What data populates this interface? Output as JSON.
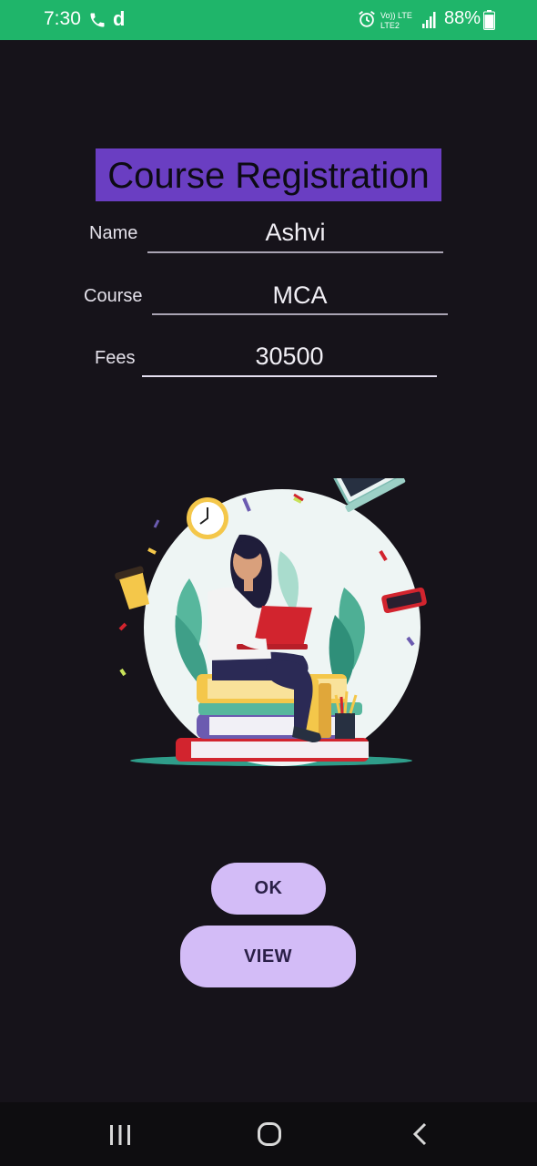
{
  "status_bar": {
    "time": "7:30",
    "app_letter": "d",
    "network_text_top": "Vo)) LTE",
    "network_text_bottom": "LTE2",
    "battery_percent": "88%",
    "battery_level": 0.88,
    "icons": [
      "phone-icon",
      "alarm-icon",
      "signal-icon",
      "battery-icon"
    ]
  },
  "title": "Course Registration",
  "fields": {
    "name": {
      "label": "Name",
      "value": "Ashvi"
    },
    "course": {
      "label": "Course",
      "value": "MCA"
    },
    "fees": {
      "label": "Fees",
      "value": "30500"
    }
  },
  "illustration": "student-studying-illustration",
  "buttons": {
    "ok": "OK",
    "view": "VIEW"
  },
  "nav_bar": {
    "icons": [
      "recents-icon",
      "home-icon",
      "back-icon"
    ]
  },
  "colors": {
    "background": "#16131a",
    "status_bar": "#1fb56a",
    "title_bg": "#6a3ec2",
    "button_bg": "#d3bcf7",
    "button_text": "#2a1f47"
  }
}
